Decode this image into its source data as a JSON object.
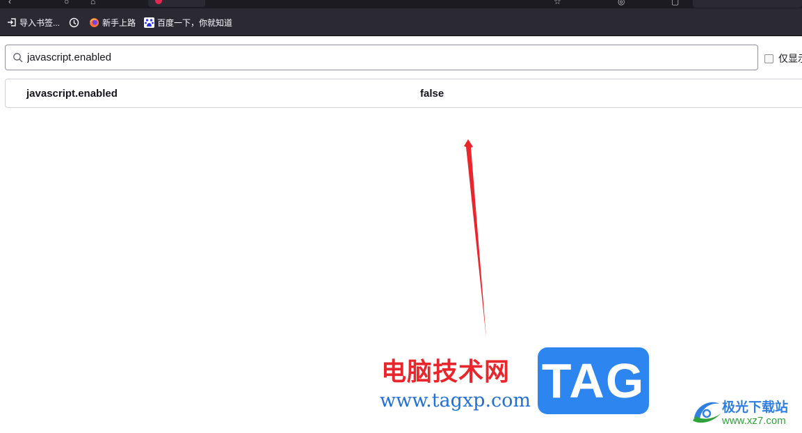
{
  "bookmarks": [
    {
      "label": "导入书签...",
      "icon": "import-icon"
    },
    {
      "label": "",
      "icon": "clock-icon"
    },
    {
      "label": "新手上路",
      "icon": "firefox-icon"
    },
    {
      "label": "百度一下，你就知道",
      "icon": "baidu-icon"
    }
  ],
  "search": {
    "value": "javascript.enabled"
  },
  "filter_checkbox": {
    "label": "仅显示"
  },
  "pref": {
    "name": "javascript.enabled",
    "value": "false"
  },
  "watermark": {
    "site_name": "电脑技术网",
    "site_url": "www.tagxp.com",
    "tag_logo": "TAG",
    "site2_name": "极光下载站",
    "site2_url": "www.xz7.com"
  },
  "colors": {
    "chrome_bg": "#2b2a33",
    "arrow": "#e8262b",
    "watermark_red": "#e8262b",
    "watermark_blue": "#2d86f0",
    "watermark_green": "#2fa33a"
  }
}
